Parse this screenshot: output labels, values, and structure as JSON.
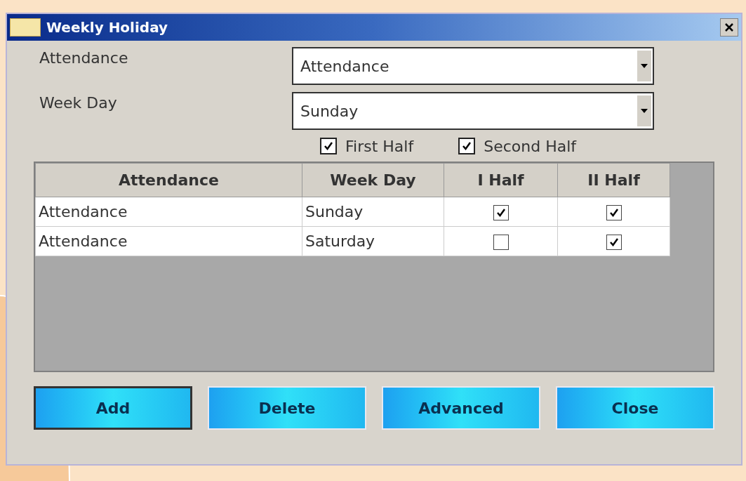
{
  "window": {
    "title": "Weekly Holiday"
  },
  "form": {
    "fields": [
      {
        "label": "Attendance",
        "value": "Attendance"
      },
      {
        "label": "Week Day",
        "value": "Sunday"
      }
    ],
    "checkboxes": [
      {
        "label": "First Half",
        "checked": true
      },
      {
        "label": "Second Half",
        "checked": true
      }
    ]
  },
  "table": {
    "columns": [
      "Attendance",
      "Week Day",
      "I Half",
      "II Half"
    ],
    "rows": [
      {
        "attendance": "Attendance",
        "week_day": "Sunday",
        "first_half": true,
        "second_half": true
      },
      {
        "attendance": "Attendance",
        "week_day": "Saturday",
        "first_half": false,
        "second_half": true
      }
    ]
  },
  "buttons": [
    {
      "label": "Add",
      "focused": true
    },
    {
      "label": "Delete",
      "focused": false
    },
    {
      "label": "Advanced",
      "focused": false
    },
    {
      "label": "Close",
      "focused": false
    }
  ]
}
